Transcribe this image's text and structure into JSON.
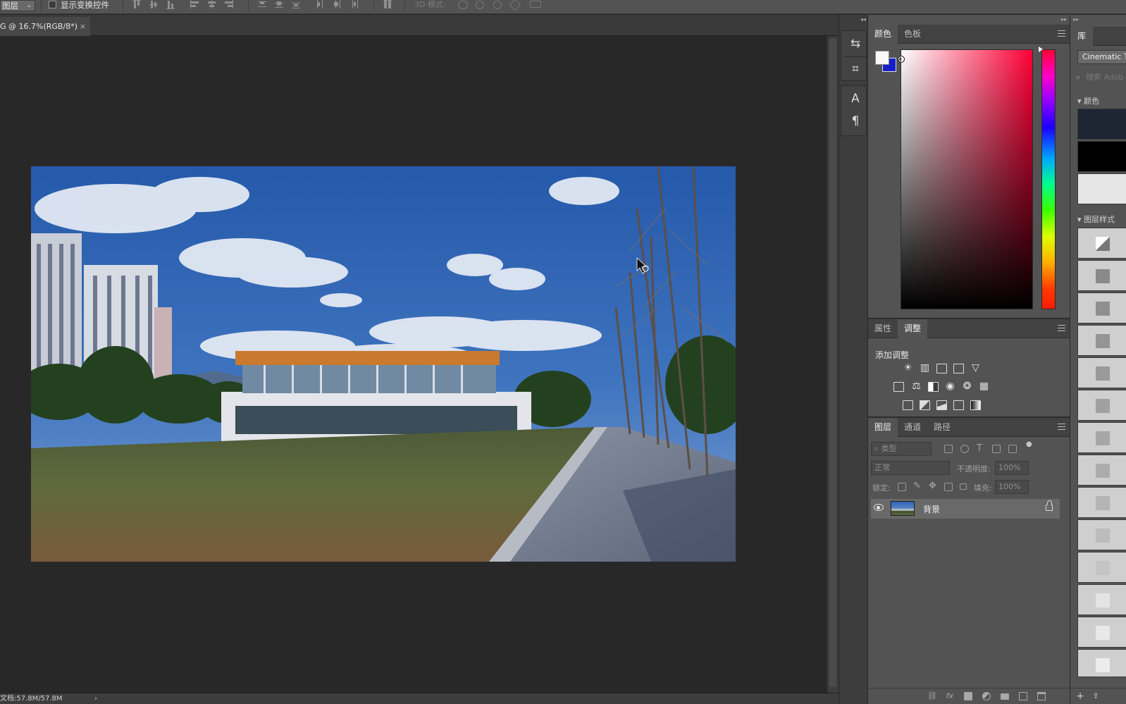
{
  "options_bar": {
    "auto_select_target": "图层",
    "show_transform_label": "显示变换控件",
    "mode_3d_label": "3D 模式:"
  },
  "document": {
    "tab_title": "G @ 16.7%(RGB/8*)",
    "close_glyph": "×",
    "status_text": "文档:57.8M/57.8M",
    "status_arrow": "›"
  },
  "color_panel": {
    "tabs": [
      "颜色",
      "色板"
    ],
    "active_tab": 0,
    "foreground_color": "#f8f8f8",
    "background_color": "#1720c8",
    "hue_color": "#ff0036"
  },
  "adjustments_panel": {
    "tabs": [
      "属性",
      "调整"
    ],
    "active_tab": 1,
    "title": "添加调整",
    "row1_icons": [
      "brightness-contrast-icon",
      "levels-icon",
      "curves-icon",
      "exposure-icon",
      "vibrance-icon"
    ],
    "row2_icons": [
      "hue-saturation-icon",
      "color-balance-icon",
      "black-white-icon",
      "photo-filter-icon",
      "channel-mixer-icon",
      "color-lookup-icon"
    ],
    "row3_icons": [
      "invert-icon",
      "posterize-icon",
      "threshold-icon",
      "selective-color-icon",
      "gradient-map-icon"
    ]
  },
  "layers_panel": {
    "tabs": [
      "图层",
      "通道",
      "路径"
    ],
    "active_tab": 0,
    "filter_kind": "类型",
    "blend_mode": "正常",
    "opacity_label": "不透明度:",
    "opacity_value": "100%",
    "lock_label": "锁定:",
    "fill_label": "填充:",
    "fill_value": "100%",
    "layers": [
      {
        "name": "背景",
        "visible": true,
        "locked": true
      }
    ],
    "footer_icons": [
      "link-layers-icon",
      "fx-icon",
      "add-mask-icon",
      "new-adjustment-icon",
      "new-group-icon",
      "new-layer-icon",
      "delete-layer-icon"
    ],
    "fx_glyph": "fx"
  },
  "library_panel": {
    "tab": "库",
    "library_name": "Cinematic Ti",
    "search_placeholder": "搜索 Adob",
    "section_colors": "颜色",
    "section_layer_styles": "图层样式",
    "color_swatches": [
      "#1f2633",
      "#000000",
      "#e6e6e6"
    ]
  }
}
